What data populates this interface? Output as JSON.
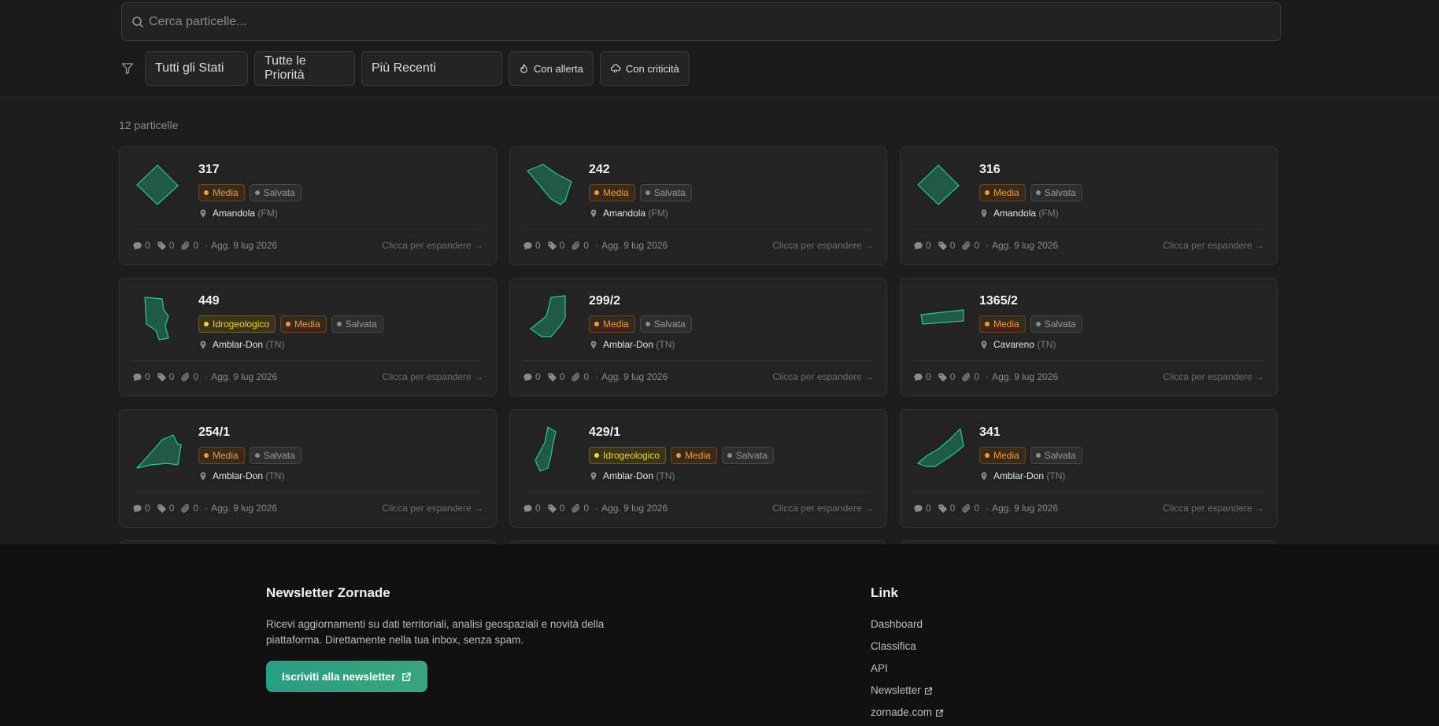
{
  "search": {
    "placeholder": "Cerca particelle..."
  },
  "filters": {
    "status": "Tutti gli Stati",
    "priority": "Tutte le Priorità",
    "sort": "Più Recenti",
    "alert_label": "Con allerta",
    "critical_label": "Con criticità"
  },
  "results": {
    "count_label": "12 particelle"
  },
  "card_common": {
    "expand_label": "Clicca per espandere →"
  },
  "cards": [
    {
      "number": "317",
      "badges": [
        {
          "text": "Media",
          "kind": "media"
        },
        {
          "text": "Salvata",
          "kind": "salvata"
        }
      ],
      "town": "Amandola",
      "province": "(FM)",
      "comments": "0",
      "tags": "0",
      "attachments": "0",
      "updated": "Agg. 9 lug 2026",
      "shape_icon": "diamond-parcel"
    },
    {
      "number": "242",
      "badges": [
        {
          "text": "Media",
          "kind": "media"
        },
        {
          "text": "Salvata",
          "kind": "salvata"
        }
      ],
      "town": "Amandola",
      "province": "(FM)",
      "comments": "0",
      "tags": "0",
      "attachments": "0",
      "updated": "Agg. 9 lug 2026",
      "shape_icon": "angled-parcel"
    },
    {
      "number": "316",
      "badges": [
        {
          "text": "Media",
          "kind": "media"
        },
        {
          "text": "Salvata",
          "kind": "salvata"
        }
      ],
      "town": "Amandola",
      "province": "(FM)",
      "comments": "0",
      "tags": "0",
      "attachments": "0",
      "updated": "Agg. 9 lug 2026",
      "shape_icon": "diamond-parcel"
    },
    {
      "number": "449",
      "badges": [
        {
          "text": "Idrogeologico",
          "kind": "idro"
        },
        {
          "text": "Media",
          "kind": "media"
        },
        {
          "text": "Salvata",
          "kind": "salvata"
        }
      ],
      "town": "Amblar-Don",
      "province": "(TN)",
      "comments": "0",
      "tags": "0",
      "attachments": "0",
      "updated": "Agg. 9 lug 2026",
      "shape_icon": "tall-parcel"
    },
    {
      "number": "299/2",
      "badges": [
        {
          "text": "Media",
          "kind": "media"
        },
        {
          "text": "Salvata",
          "kind": "salvata"
        }
      ],
      "town": "Amblar-Don",
      "province": "(TN)",
      "comments": "0",
      "tags": "0",
      "attachments": "0",
      "updated": "Agg. 9 lug 2026",
      "shape_icon": "boot-parcel"
    },
    {
      "number": "1365/2",
      "badges": [
        {
          "text": "Media",
          "kind": "media"
        },
        {
          "text": "Salvata",
          "kind": "salvata"
        }
      ],
      "town": "Cavareno",
      "province": "(TN)",
      "comments": "0",
      "tags": "0",
      "attachments": "0",
      "updated": "Agg. 9 lug 2026",
      "shape_icon": "strip-parcel"
    },
    {
      "number": "254/1",
      "badges": [
        {
          "text": "Media",
          "kind": "media"
        },
        {
          "text": "Salvata",
          "kind": "salvata"
        }
      ],
      "town": "Amblar-Don",
      "province": "(TN)",
      "comments": "0",
      "tags": "0",
      "attachments": "0",
      "updated": "Agg. 9 lug 2026",
      "shape_icon": "irregular-parcel"
    },
    {
      "number": "429/1",
      "badges": [
        {
          "text": "Idrogeologico",
          "kind": "idro"
        },
        {
          "text": "Media",
          "kind": "media"
        },
        {
          "text": "Salvata",
          "kind": "salvata"
        }
      ],
      "town": "Amblar-Don",
      "province": "(TN)",
      "comments": "0",
      "tags": "0",
      "attachments": "0",
      "updated": "Agg. 9 lug 2026",
      "shape_icon": "narrow-parcel"
    },
    {
      "number": "341",
      "badges": [
        {
          "text": "Media",
          "kind": "media"
        },
        {
          "text": "Salvata",
          "kind": "salvata"
        }
      ],
      "town": "Amblar-Don",
      "province": "(TN)",
      "comments": "0",
      "tags": "0",
      "attachments": "0",
      "updated": "Agg. 9 lug 2026",
      "shape_icon": "diagonal-parcel"
    }
  ],
  "footer": {
    "newsletter_title": "Newsletter Zornade",
    "newsletter_text": "Ricevi aggiornamenti su dati territoriali, analisi geospaziali e novità della piattaforma. Direttamente nella tua inbox, senza spam.",
    "newsletter_button": "Iscriviti alla newsletter",
    "links_title": "Link",
    "links": [
      {
        "label": "Dashboard",
        "external": false
      },
      {
        "label": "Classifica",
        "external": false
      },
      {
        "label": "API",
        "external": false
      },
      {
        "label": "Newsletter",
        "external": true
      },
      {
        "label": "zornade.com",
        "external": true
      }
    ]
  },
  "colors": {
    "background": "#1d1d1d",
    "card": "#232323",
    "parcel_fill": "#1f5a46",
    "parcel_stroke": "#2fc693",
    "media": "#f29a3a",
    "idrogeologico": "#f3d23a",
    "accent": "#2a9d86"
  }
}
